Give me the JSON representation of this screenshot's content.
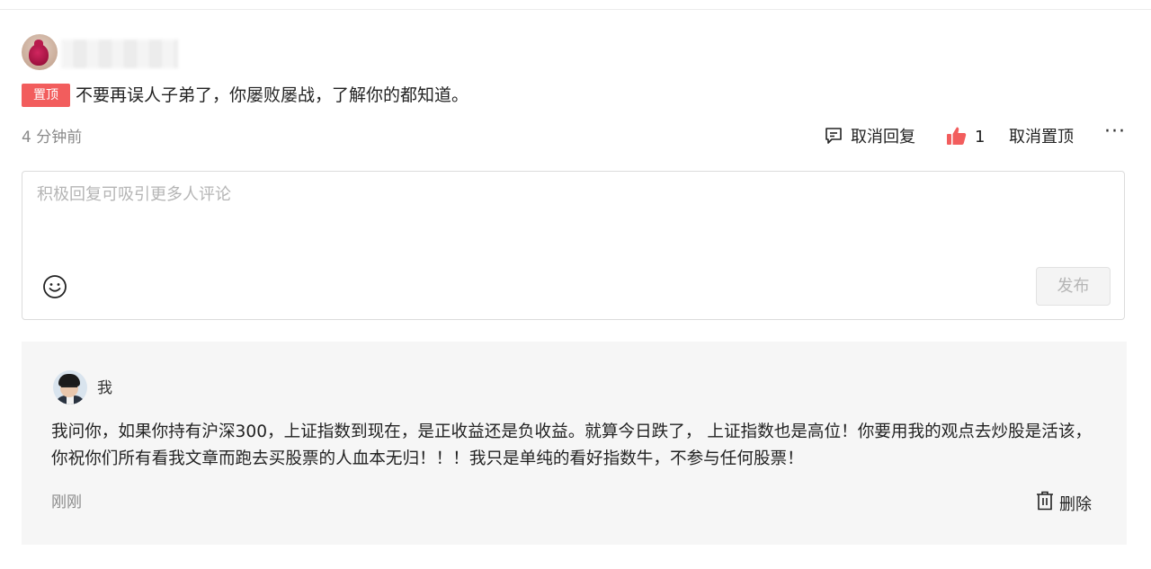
{
  "comment": {
    "pin_badge": "置顶",
    "text": "不要再误人子弟了，你屡败屡战，了解你的都知道。",
    "time": "4 分钟前",
    "actions": {
      "reply_label": "取消回复",
      "like_count": "1",
      "unpin_label": "取消置顶",
      "more_label": "···"
    }
  },
  "reply_input": {
    "placeholder": "积极回复可吸引更多人评论",
    "publish_label": "发布"
  },
  "reply": {
    "author": "我",
    "text": "我问你，如果你持有沪深300，上证指数到现在，是正收益还是负收益。就算今日跌了， 上证指数也是高位！你要用我的观点去炒股是活该，你祝你们所有看我文章而跑去买股票的人血本无归！！！我只是单纯的看好指数牛，不参与任何股票！",
    "time": "刚刚",
    "delete_label": "删除"
  },
  "colors": {
    "pin_badge_bg": "#f25d5d",
    "like_icon": "#f25d5d",
    "muted_text": "#8a8a8a",
    "panel_bg": "#f6f6f6"
  },
  "icons": {
    "reply": "comment-icon",
    "like": "thumbs-up-icon",
    "emoji": "smiley-icon",
    "delete": "trash-icon"
  }
}
